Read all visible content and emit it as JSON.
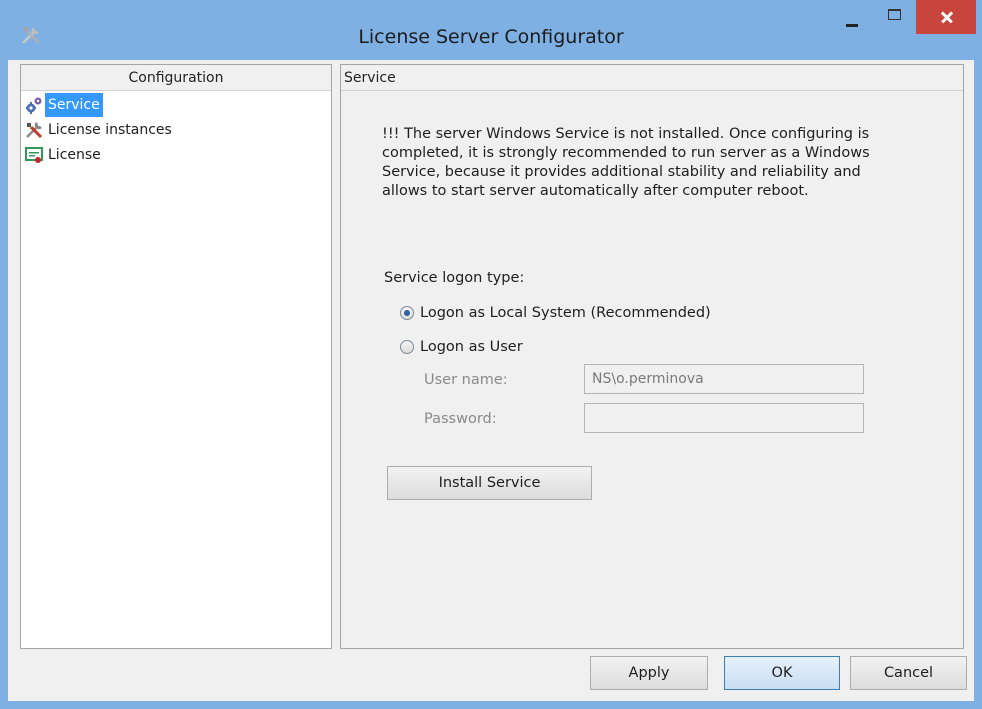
{
  "window": {
    "title": "License Server Configurator"
  },
  "left_panel": {
    "header": "Configuration",
    "items": [
      {
        "label": "Service",
        "icon": "gears-icon",
        "selected": true
      },
      {
        "label": "License instances",
        "icon": "tools-icon",
        "selected": false
      },
      {
        "label": "License",
        "icon": "certificate-icon",
        "selected": false
      }
    ]
  },
  "right_panel": {
    "header": "Service",
    "warning_lines": [
      "!!! The server Windows Service is not installed. Once configuring is",
      "completed, it is strongly recommended to run server as a Windows",
      "Service, because it provides additional stability and reliability and",
      "allows to start server automatically after computer reboot."
    ],
    "logon_type_label": "Service logon type:",
    "radio_local": "Logon as Local System (Recommended)",
    "radio_user": "Logon as User",
    "selected_logon": "local",
    "user_name_label": "User name:",
    "user_name_value": "NS\\o.perminova",
    "password_label": "Password:",
    "password_value": "",
    "install_button": "Install Service"
  },
  "footer": {
    "apply": "Apply",
    "ok": "OK",
    "cancel": "Cancel"
  },
  "colors": {
    "titlebar": "#7fb0e4",
    "close_button": "#c8453d",
    "selection": "#3399ff"
  }
}
